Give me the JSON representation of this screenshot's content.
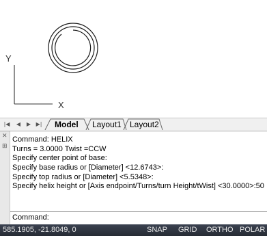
{
  "canvas": {
    "ucs_x_label": "X",
    "ucs_y_label": "Y"
  },
  "layout_tabs": {
    "nav_buttons": [
      "first-tab",
      "previous-tab",
      "next-tab",
      "last-tab"
    ],
    "tabs": [
      {
        "label": "Model",
        "active": true
      },
      {
        "label": "Layout1",
        "active": false
      },
      {
        "label": "Layout2",
        "active": false
      }
    ]
  },
  "command_window": {
    "history": [
      "Command: HELIX",
      "Turns = 3.0000 Twist =CCW",
      "Specify center point of base:",
      "Specify base radius or [Diameter] <12.6743>:",
      "Specify top radius or [Diameter] <5.5348>:",
      "Specify helix height or [Axis endpoint/Turns/turn Height/tWist] <30.0000>:50"
    ],
    "prompt": "Command:",
    "grip_icons": [
      "close-icon",
      "pin-icon"
    ]
  },
  "status_bar": {
    "coordinates": "585.1905, -21.8049, 0",
    "toggles": [
      "SNAP",
      "GRID",
      "ORTHO",
      "POLAR"
    ]
  },
  "colors": {
    "status_bar_bg": "#2e3440",
    "status_text": "#e8e8e8",
    "drawing_stroke": "#1a1a1a"
  }
}
